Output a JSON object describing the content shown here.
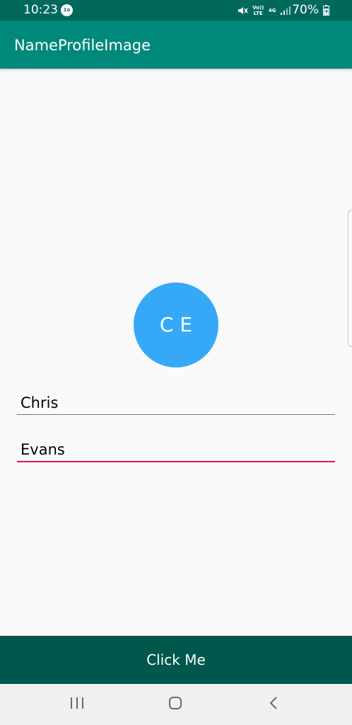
{
  "status_bar": {
    "time": "10:23",
    "notification_badge": "1o",
    "network_volte": "Vo)) LTE",
    "network_type": "4G",
    "battery_percent": "70%",
    "icons": [
      "mute-icon",
      "signal-icon",
      "battery-charging-icon"
    ]
  },
  "app_bar": {
    "title": "NameProfileImage",
    "color": "#00897b"
  },
  "avatar": {
    "initials": "C E",
    "color": "#35a9f8"
  },
  "form": {
    "first_name": "Chris",
    "last_name": "Evans",
    "focus_color": "#d81b60"
  },
  "action": {
    "button_label": "Click Me",
    "color": "#00574b"
  },
  "navigation": {
    "icons": [
      "recents-icon",
      "home-icon",
      "back-icon"
    ]
  }
}
